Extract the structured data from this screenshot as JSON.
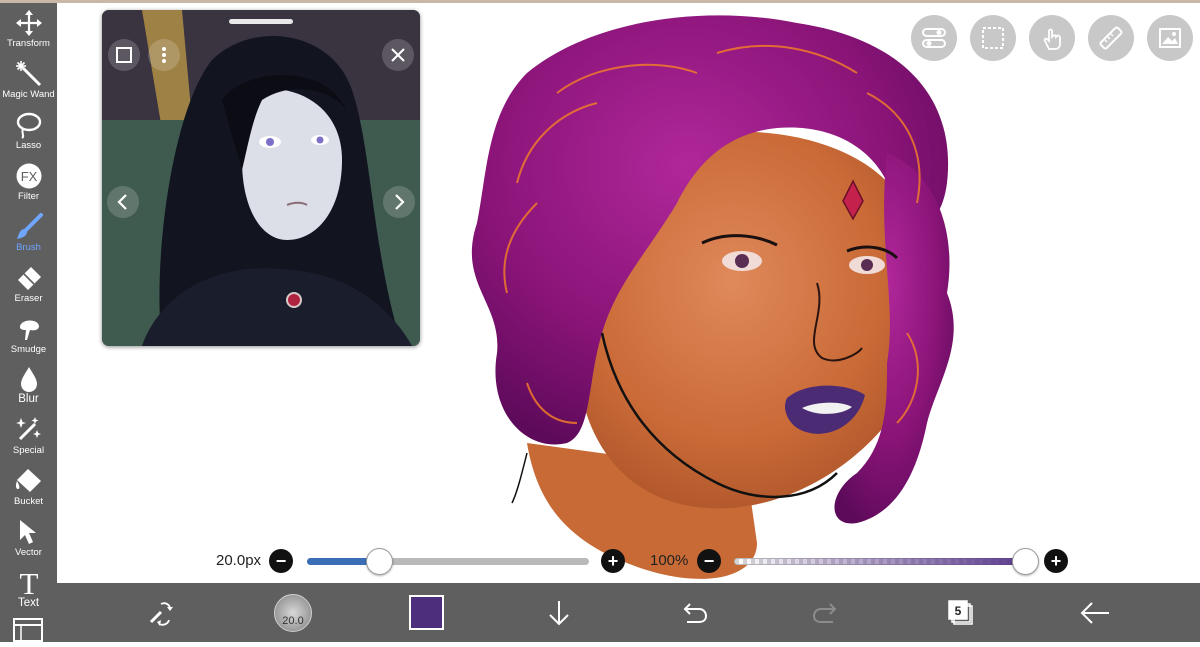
{
  "tools": [
    {
      "label": "Transform",
      "icon": "transform-icon"
    },
    {
      "label": "Magic Wand",
      "icon": "magic-wand-icon"
    },
    {
      "label": "Lasso",
      "icon": "lasso-icon"
    },
    {
      "label": "Filter",
      "icon": "filter-icon",
      "glyph": "FX"
    },
    {
      "label": "Brush",
      "icon": "brush-icon",
      "active": true
    },
    {
      "label": "Eraser",
      "icon": "eraser-icon"
    },
    {
      "label": "Smudge",
      "icon": "smudge-icon"
    },
    {
      "label": "Blur",
      "icon": "blur-icon"
    },
    {
      "label": "Special",
      "icon": "special-icon"
    },
    {
      "label": "Bucket",
      "icon": "bucket-icon"
    },
    {
      "label": "Vector",
      "icon": "vector-icon"
    },
    {
      "label": "Text",
      "icon": "text-icon",
      "glyph": "T"
    }
  ],
  "brush_size": {
    "label": "20.0px",
    "minus": "−",
    "plus": "+",
    "level": 0.25
  },
  "opacity": {
    "label": "100%",
    "minus": "−",
    "plus": "+",
    "level": 1.0
  },
  "bottom_bar": {
    "brush_preview_value": "20.0",
    "current_color": "#4d2e7d",
    "layer_count": "5"
  },
  "colors": {
    "toolbar": "#5f5f5f",
    "accent": "#6fa6ff",
    "slider_fill": "#3a6fb7",
    "opacity_fill": "#5a3a8c"
  }
}
